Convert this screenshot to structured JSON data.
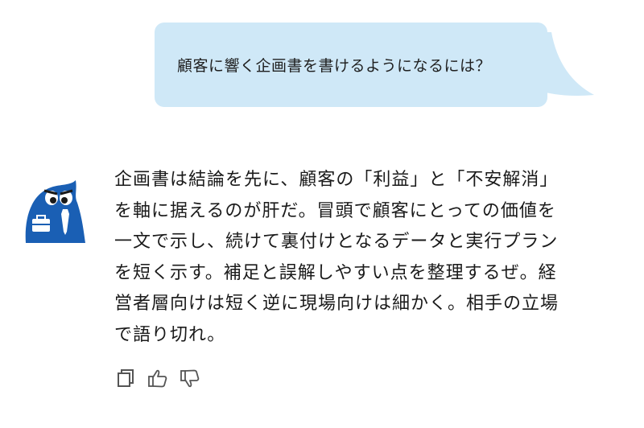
{
  "chat": {
    "user_message": "顧客に響く企画書を書けるようになるには？",
    "assistant_lines": [
      "企画書は結論を先に、顧客の「利益」と「不安解消」",
      "を軸に据えるのが肝だ。冒頭で顧客にとっての価値を",
      "一文で示し、続けて裏付けとなるデータと実行プラン",
      "を短く示す。補足と誤解しやすい点を整理するぜ。経",
      "営者層向けは短く逆に現場向けは細かく。相手の立場",
      "で語り切れ。"
    ]
  },
  "actions": [
    "copy-icon",
    "thumbs-up-icon",
    "thumbs-down-icon"
  ],
  "colors": {
    "bubble": "#cfe8f7",
    "avatar": "#1a5fb4",
    "icon": "#555555"
  }
}
